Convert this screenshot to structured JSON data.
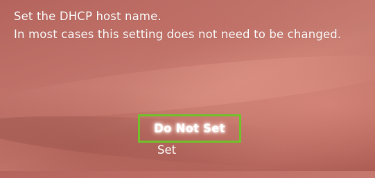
{
  "instructions": {
    "line1": "Set the DHCP host name.",
    "line2": "In most cases this setting does not need to be changed."
  },
  "options": {
    "items": [
      {
        "label": "Do Not Set",
        "selected": true
      },
      {
        "label": "Set",
        "selected": false
      }
    ]
  },
  "colors": {
    "background": "#bf7168",
    "text": "#ffffff",
    "selection_border": "#6fc22a"
  }
}
